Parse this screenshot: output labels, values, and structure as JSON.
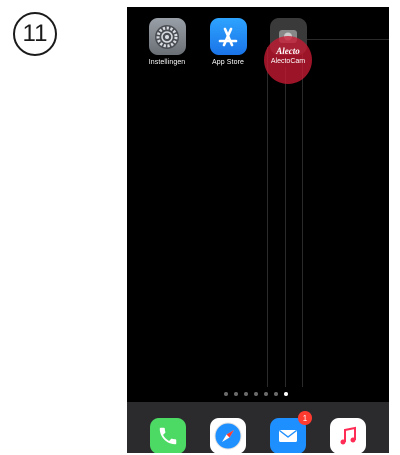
{
  "step": {
    "number": "11"
  },
  "home_screen": {
    "apps": [
      {
        "label": "Instellingen",
        "icon": "settings-gear-icon"
      },
      {
        "label": "App Store",
        "icon": "app-store-icon"
      },
      {
        "label": "AlectoCam",
        "icon": "alecto-cam-icon",
        "logo_text": "Alecto"
      }
    ],
    "page_count": 7,
    "active_page": 7
  },
  "dock": {
    "apps": [
      {
        "name": "phone",
        "icon": "phone-icon"
      },
      {
        "name": "safari",
        "icon": "safari-compass-icon"
      },
      {
        "name": "mail",
        "icon": "mail-envelope-icon",
        "badge": "1"
      },
      {
        "name": "music",
        "icon": "music-note-icon"
      }
    ]
  },
  "colors": {
    "highlight": "#c81932",
    "screen_background": "#000000",
    "dock_background": "#2b2b2e",
    "badge": "#ff3b30"
  }
}
